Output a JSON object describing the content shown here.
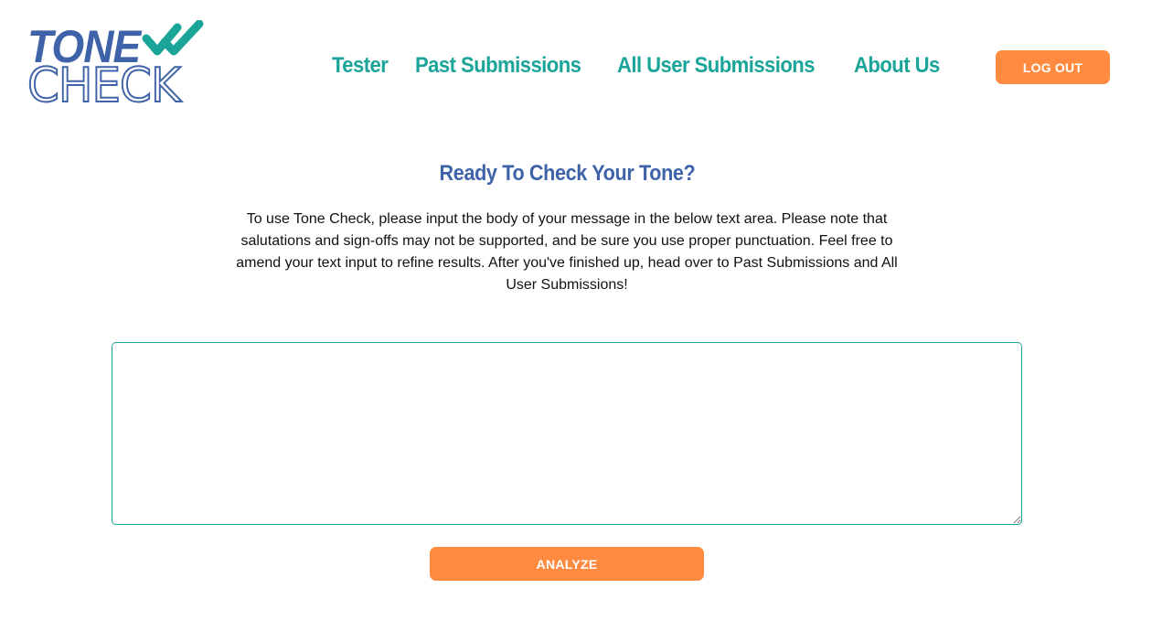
{
  "logo": {
    "line1": "TONE",
    "line2": "CHECK",
    "icon": "double-checkmark-icon",
    "colors": {
      "primary": "#3f63a8",
      "accent": "#1aa598"
    }
  },
  "nav": {
    "items": [
      {
        "label": "Tester"
      },
      {
        "label": "Past Submissions"
      },
      {
        "label": "All User Submissions"
      },
      {
        "label": "About Us"
      }
    ]
  },
  "header": {
    "logout_label": "LOG OUT"
  },
  "main": {
    "heading": "Ready To Check Your Tone?",
    "intro": "To use Tone Check, please input the body of your message in the below text area. Please note that salutations and sign-offs may not be supported, and be sure you use proper punctuation. Feel free to amend your text input to refine results. After you've finished up, head over to Past Submissions and All User Submissions!",
    "message_value": "",
    "analyze_label": "ANALYZE"
  },
  "theme": {
    "brand_blue": "#3f63a8",
    "brand_teal": "#1aa598",
    "button_orange": "#ff8a40"
  }
}
